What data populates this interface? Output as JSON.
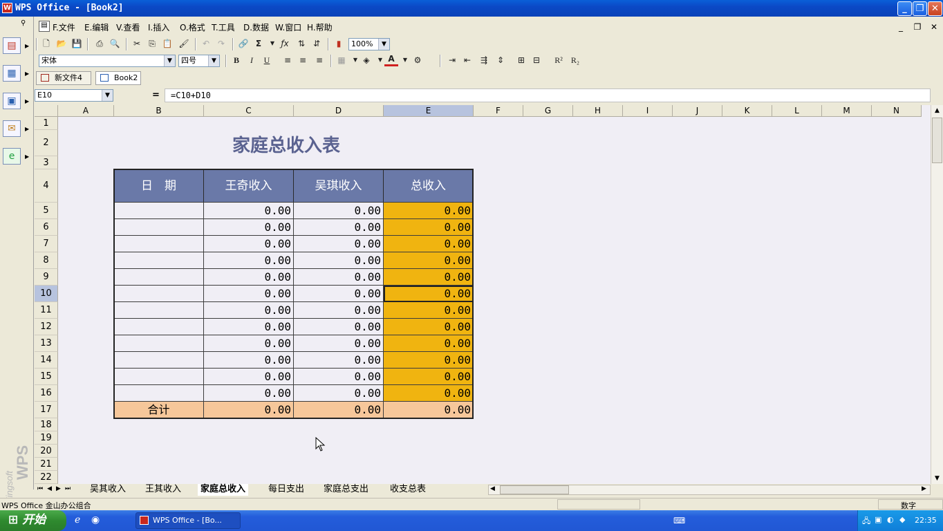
{
  "window": {
    "title": "WPS Office - [Book2]",
    "icon": "wps-app-icon"
  },
  "menu": [
    "F.文件",
    "E.编辑",
    "V.查看",
    "I.插入",
    "O.格式",
    "T.工具",
    "D.数据",
    "W.窗口",
    "H.帮助"
  ],
  "toolbar": {
    "zoom": "100%",
    "font": "宋体",
    "font_size": "四号"
  },
  "doc_tabs": [
    "新文件4",
    "Book2"
  ],
  "formula": {
    "name_box": "E10",
    "eq": "=",
    "content": "=C10+D10"
  },
  "columns": [
    "A",
    "B",
    "C",
    "D",
    "E",
    "F",
    "G",
    "H",
    "I",
    "J",
    "K",
    "L",
    "M",
    "N"
  ],
  "rows": [
    "1",
    "2",
    "3",
    "4",
    "5",
    "6",
    "7",
    "8",
    "9",
    "10",
    "11",
    "12",
    "13",
    "14",
    "15",
    "16",
    "17",
    "18",
    "19",
    "20",
    "21",
    "22"
  ],
  "sheet": {
    "title": "家庭总收入表",
    "headers": [
      "日　期",
      "王奇收入",
      "吴琪收入",
      "总收入"
    ],
    "zero": "0.00",
    "total_label": "合计"
  },
  "sheet_tabs": [
    "吴其收入",
    "王其收入",
    "家庭总收入",
    "每日支出",
    "家庭总支出",
    "收支总表"
  ],
  "status": {
    "left": "WPS Office 金山办公组合",
    "right": "数字"
  },
  "taskbar": {
    "start": "开始",
    "task": "WPS Office - [Bo...",
    "clock": "22:35"
  },
  "colors": {
    "header_fill": "#6a79a8",
    "total_fill": "#f0b410",
    "sum_row_fill": "#f6c79a",
    "title_color": "#5a6290"
  }
}
